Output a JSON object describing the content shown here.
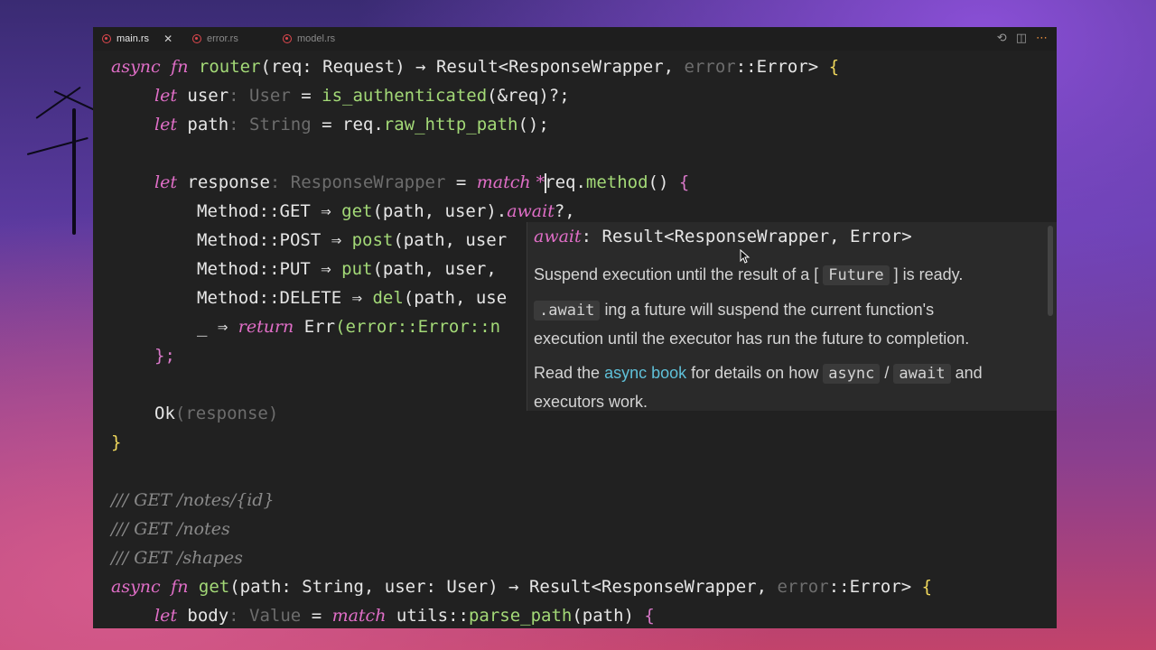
{
  "tabs": [
    {
      "label": "main.rs",
      "active": true
    },
    {
      "label": "error.rs",
      "active": false
    },
    {
      "label": "model.rs",
      "active": false
    }
  ],
  "code": {
    "l1": {
      "a": "async",
      "b": "fn",
      "c": "router",
      "d": "(req: Request) → Result<ResponseWrapper, ",
      "e": "error",
      "f": "::Error> ",
      "g": "{"
    },
    "l2": {
      "a": "let",
      "b": " user",
      "c": ": User",
      "d": " = ",
      "e": "is_authenticated",
      "f": "(&req)?;"
    },
    "l3": {
      "a": "let",
      "b": " path",
      "c": ": String",
      "d": " = req.",
      "e": "raw_http_path",
      "f": "();"
    },
    "l5": {
      "a": "let",
      "b": " response",
      "c": ": ResponseWrapper",
      "d": " = ",
      "e": "match",
      "f": " *",
      "g": "req.",
      "h": "method",
      "i": "() ",
      "j": "{"
    },
    "l6": {
      "a": "Method::GET ⇒ ",
      "b": "get",
      "c": "(path, user).",
      "d": "await",
      "e": "?,"
    },
    "l7": {
      "a": "Method::POST ⇒ ",
      "b": "post",
      "c": "(path, user"
    },
    "l8": {
      "a": "Method::PUT ⇒ ",
      "b": "put",
      "c": "(path, user,"
    },
    "l9": {
      "a": "Method::DELETE ⇒ ",
      "b": "del",
      "c": "(path, use"
    },
    "l10": {
      "a": "_ ⇒ ",
      "b": "return",
      "c": " Err",
      "d": "(error::Error::n"
    },
    "l11": {
      "a": "};"
    },
    "l13": {
      "a": "Ok",
      "b": "(response)"
    },
    "l14": {
      "a": "}"
    },
    "l16": {
      "a": "/// GET /notes/{id}"
    },
    "l17": {
      "a": "/// GET /notes"
    },
    "l18": {
      "a": "/// GET /shapes"
    },
    "l19": {
      "a": "async",
      "b": "fn",
      "c": "get",
      "d": "(path: String, user: User) → Result<ResponseWrapper, ",
      "e": "error",
      "f": "::Error> ",
      "g": "{"
    },
    "l20": {
      "a": "let",
      "b": " body",
      "c": ": Value",
      "d": " = ",
      "e": "match",
      "f": " utils::",
      "g": "parse_path",
      "h": "(path) ",
      "i": "{"
    }
  },
  "popup": {
    "sig_name": "await",
    "sig_rest": ": Result<ResponseWrapper, Error>",
    "p1_pre": "Suspend execution until the result of a [",
    "p1_code": "Future",
    "p1_post": "] is ready.",
    "p2_code": ".await",
    "p2_post": "ing a future will suspend the current function's",
    "p3": "execution until the executor has run the future to completion.",
    "p4_pre": "Read the ",
    "p4_link": "async book",
    "p4_mid": " for details on how ",
    "p4_code1": "async",
    "p4_slash": " / ",
    "p4_code2": "await",
    "p4_post": " and",
    "p5": "executors work."
  },
  "icons": {
    "history": "history-icon",
    "split": "split-editor-icon",
    "more": "more-icon"
  }
}
